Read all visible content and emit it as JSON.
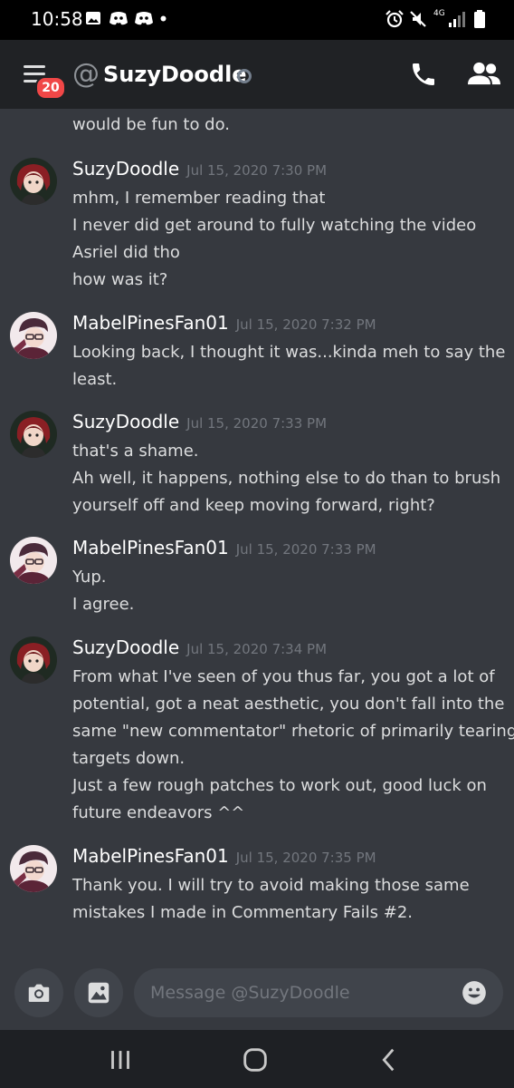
{
  "status_bar": {
    "time": "10:58",
    "network": "4G",
    "left_icons": [
      "image-icon",
      "discord-icon",
      "discord-icon",
      "dot-icon"
    ],
    "right_icons": [
      "alarm-icon",
      "mute-icon",
      "signal-icon",
      "battery-icon"
    ]
  },
  "header": {
    "menu_badge": "20",
    "at_symbol": "@",
    "title": "SuzyDoodle",
    "status": "offline",
    "actions": [
      "phone-icon",
      "members-icon"
    ]
  },
  "messages": {
    "continuation": "would be fun to do.",
    "groups": [
      {
        "author": "SuzyDoodle",
        "timestamp": "Jul 15, 2020 7:30 PM",
        "lines": [
          "mhm, I remember reading that",
          "I never did get around to fully watching the video",
          "Asriel did tho",
          "how was it?"
        ]
      },
      {
        "author": "MabelPinesFan01",
        "timestamp": "Jul 15, 2020 7:32 PM",
        "lines": [
          "Looking back, I thought it was...kinda meh to say the",
          "least."
        ]
      },
      {
        "author": "SuzyDoodle",
        "timestamp": "Jul 15, 2020 7:33 PM",
        "lines": [
          "that's a shame.",
          "Ah well, it happens, nothing else to do than to brush",
          "yourself off and keep moving forward, right?"
        ]
      },
      {
        "author": "MabelPinesFan01",
        "timestamp": "Jul 15, 2020 7:33 PM",
        "lines": [
          "Yup.",
          "I agree."
        ]
      },
      {
        "author": "SuzyDoodle",
        "timestamp": "Jul 15, 2020 7:34 PM",
        "lines": [
          "From what I've seen of you thus far, you got a lot of",
          "potential, got a neat aesthetic, you don't fall into the",
          "same \"new commentator\" rhetoric of primarily tearing",
          "targets down.",
          "Just a few rough patches to work out, good luck on",
          "future endeavors ^^"
        ]
      },
      {
        "author": "MabelPinesFan01",
        "timestamp": "Jul 15, 2020 7:35 PM",
        "lines": [
          "Thank you. I will try to avoid making those same",
          "mistakes I made in Commentary Fails #2."
        ]
      }
    ]
  },
  "composer": {
    "placeholder": "Message @SuzyDoodle",
    "buttons": [
      "camera-icon",
      "gallery-icon",
      "emoji-icon"
    ]
  },
  "colors": {
    "background": "#36393f",
    "header": "#202225",
    "input": "#40444b",
    "username": "#ffffff",
    "timestamp": "#72767d",
    "badge": "#f04747"
  }
}
